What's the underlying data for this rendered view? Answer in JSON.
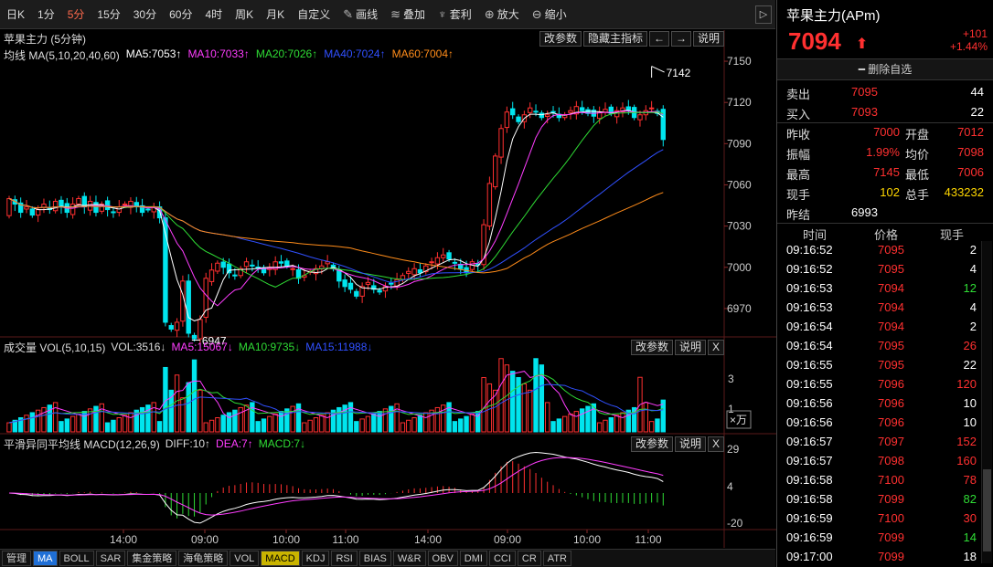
{
  "toolbar": {
    "periods": [
      "日K",
      "1分",
      "5分",
      "15分",
      "30分",
      "60分",
      "4时",
      "周K",
      "月K",
      "自定义"
    ],
    "active_period": "5分",
    "tools": [
      {
        "label": "画线",
        "icon": "pencil-icon"
      },
      {
        "label": "叠加",
        "icon": "stack-icon"
      },
      {
        "label": "套利",
        "icon": "money-bag-icon"
      },
      {
        "label": "放大",
        "icon": "zoom-in-icon"
      },
      {
        "label": "缩小",
        "icon": "zoom-out-icon"
      }
    ]
  },
  "main_panel": {
    "title": "苹果主力 (5分钟)",
    "buttons": [
      "改参数",
      "隐藏主指标",
      "←",
      "→",
      "说明"
    ],
    "ma_label": "均线 MA(5,10,20,40,60)",
    "ma_values": [
      {
        "text": "MA5:7053↑",
        "color": "#ffffff"
      },
      {
        "text": "MA10:7033↑",
        "color": "#ff3dff"
      },
      {
        "text": "MA20:7026↑",
        "color": "#2fdc35"
      },
      {
        "text": "MA40:7024↑",
        "color": "#3050ff"
      },
      {
        "text": "MA60:7004↑",
        "color": "#ff8c1a"
      }
    ],
    "y_ticks": [
      "7150",
      "7120",
      "7090",
      "7060",
      "7030",
      "7000",
      "6970"
    ],
    "high_label": "7142",
    "low_label": "6947"
  },
  "vol_panel": {
    "label": "成交量 VOL(5,10,15)",
    "vol": "VOL:3516↓",
    "ma5": "MA5:15067↓",
    "ma10": "MA10:9735↓",
    "ma15": "MA15:11988↓",
    "buttons": [
      "改参数",
      "说明",
      "X"
    ],
    "y_ticks": [
      "3",
      "1"
    ],
    "unit": "×万"
  },
  "macd_panel": {
    "label": "平滑异同平均线 MACD(12,26,9)",
    "diff": "DIFF:10↑",
    "dea": "DEA:7↑",
    "macd": "MACD:7↓",
    "buttons": [
      "改参数",
      "说明",
      "X"
    ],
    "y_ticks": [
      "29",
      "4",
      "-20"
    ]
  },
  "x_axis": [
    "14:00",
    "09:00",
    "10:00",
    "11:00",
    "14:00",
    "09:00",
    "10:00",
    "11:00"
  ],
  "bottom_tabs": [
    "管理",
    "MA",
    "BOLL",
    "SAR",
    "集金策略",
    "海龟策略",
    "VOL",
    "MACD",
    "KDJ",
    "RSI",
    "BIAS",
    "W&R",
    "OBV",
    "DMI",
    "CCI",
    "CR",
    "ATR"
  ],
  "quote": {
    "name": "苹果主力(APm)",
    "price": "7094",
    "change": "+101",
    "change_pct": "+1.44%",
    "remove_watch": "删除自选",
    "sell_label": "卖出",
    "sell_price": "7095",
    "sell_qty": "44",
    "buy_label": "买入",
    "buy_price": "7093",
    "buy_qty": "22",
    "stats": [
      {
        "l1": "昨收",
        "v1": "7000",
        "c1": "red",
        "l2": "开盘",
        "v2": "7012",
        "c2": "red"
      },
      {
        "l1": "振幅",
        "v1": "1.99%",
        "c1": "red",
        "l2": "均价",
        "v2": "7098",
        "c2": "red"
      },
      {
        "l1": "最高",
        "v1": "7145",
        "c1": "red",
        "l2": "最低",
        "v2": "7006",
        "c2": "red"
      },
      {
        "l1": "现手",
        "v1": "102",
        "c1": "yellow",
        "l2": "总手",
        "v2": "433232",
        "c2": "yellow"
      }
    ],
    "settle_label": "昨结",
    "settle_value": "6993",
    "trade_headers": [
      "时间",
      "价格",
      "现手"
    ],
    "trades": [
      {
        "time": "09:16:52",
        "price": "7095",
        "qty": "2",
        "qc": "white"
      },
      {
        "time": "09:16:52",
        "price": "7095",
        "qty": "4",
        "qc": "white"
      },
      {
        "time": "09:16:53",
        "price": "7094",
        "qty": "12",
        "qc": "green"
      },
      {
        "time": "09:16:53",
        "price": "7094",
        "qty": "4",
        "qc": "white"
      },
      {
        "time": "09:16:54",
        "price": "7094",
        "qty": "2",
        "qc": "white"
      },
      {
        "time": "09:16:54",
        "price": "7095",
        "qty": "26",
        "qc": "red"
      },
      {
        "time": "09:16:55",
        "price": "7095",
        "qty": "22",
        "qc": "white"
      },
      {
        "time": "09:16:55",
        "price": "7096",
        "qty": "120",
        "qc": "red"
      },
      {
        "time": "09:16:56",
        "price": "7096",
        "qty": "10",
        "qc": "white"
      },
      {
        "time": "09:16:56",
        "price": "7096",
        "qty": "10",
        "qc": "white"
      },
      {
        "time": "09:16:57",
        "price": "7097",
        "qty": "152",
        "qc": "red"
      },
      {
        "time": "09:16:57",
        "price": "7098",
        "qty": "160",
        "qc": "red"
      },
      {
        "time": "09:16:58",
        "price": "7100",
        "qty": "78",
        "qc": "red"
      },
      {
        "time": "09:16:58",
        "price": "7099",
        "qty": "82",
        "qc": "green"
      },
      {
        "time": "09:16:59",
        "price": "7100",
        "qty": "30",
        "qc": "red"
      },
      {
        "time": "09:16:59",
        "price": "7099",
        "qty": "14",
        "qc": "green"
      },
      {
        "time": "09:17:00",
        "price": "7099",
        "qty": "18",
        "qc": "white"
      }
    ]
  },
  "chart_data": {
    "type": "candlestick",
    "price_range": [
      6950,
      7160
    ],
    "closes": [
      7050,
      7046,
      7040,
      7044,
      7038,
      7042,
      7046,
      7042,
      7048,
      7044,
      7040,
      7046,
      7050,
      7044,
      7048,
      7040,
      7046,
      7042,
      7040,
      7044,
      7046,
      7048,
      7044,
      7040,
      7042,
      7044,
      7036,
      6960,
      6955,
      6960,
      6990,
      6952,
      6948,
      6962,
      6992,
      6998,
      7003,
      7000,
      6996,
      6994,
      6999,
      7004,
      7001,
      6999,
      6996,
      7000,
      7004,
      7003,
      7001,
      6999,
      6992,
      6994,
      6997,
      6999,
      7001,
      7004,
      6999,
      6990,
      6986,
      6984,
      6979,
      6986,
      6989,
      6984,
      6982,
      6986,
      6988,
      6991,
      6994,
      6997,
      6999,
      6996,
      7001,
      7004,
      7007,
      7009,
      7006,
      7003,
      6999,
      6996,
      7004,
      7002,
      7031,
      7061,
      7081,
      7101,
      7113,
      7111,
      7106,
      7111,
      7116,
      7113,
      7109,
      7111,
      7113,
      7109,
      7111,
      7114,
      7117,
      7114,
      7112,
      7110,
      7113,
      7115,
      7112,
      7114,
      7116,
      7114,
      7109,
      7111,
      7114,
      7116,
      7112,
      7093
    ],
    "ma_last": {
      "MA5": 7053,
      "MA10": 7033,
      "MA20": 7026,
      "MA40": 7024,
      "MA60": 7004
    }
  }
}
